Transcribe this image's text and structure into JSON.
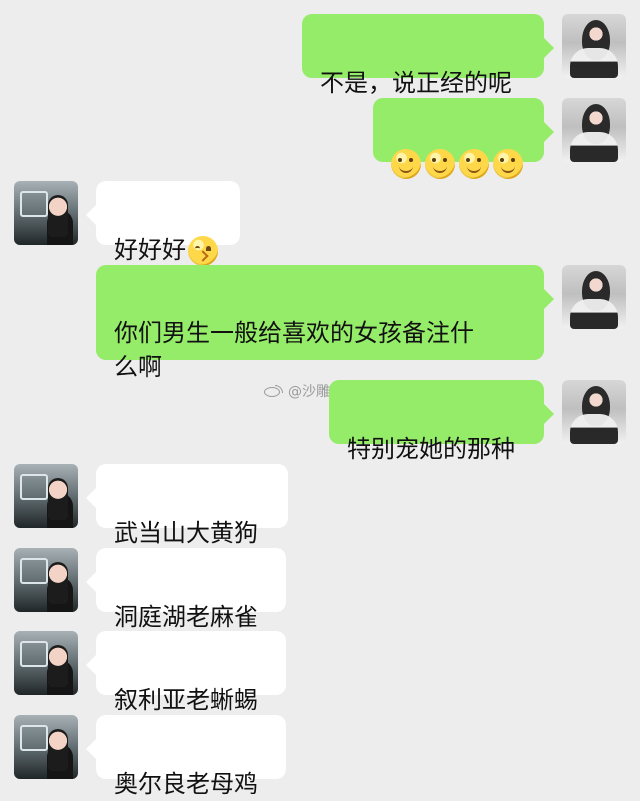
{
  "watermark": {
    "text": "@沙雕组织",
    "icon": "weibo-icon"
  },
  "messages": [
    {
      "side": "right",
      "text": "不是，说正经的呢",
      "avatar_icon": "female-avatar-icon"
    },
    {
      "side": "right",
      "emoji_count": 4,
      "emoji_icon": "smiling-face-icon",
      "avatar_icon": "female-avatar-icon"
    },
    {
      "side": "left",
      "text": "好好好",
      "emoji_icon": "kissing-face-icon",
      "avatar_icon": "male-avatar-icon"
    },
    {
      "side": "right",
      "text": "你们男生一般给喜欢的女孩备注什\n么啊",
      "avatar_icon": "female-avatar-icon"
    },
    {
      "side": "right",
      "text": "特别宠她的那种",
      "avatar_icon": "female-avatar-icon"
    },
    {
      "side": "left",
      "text": "武当山大黄狗",
      "avatar_icon": "male-avatar-icon"
    },
    {
      "side": "left",
      "text": "洞庭湖老麻雀",
      "avatar_icon": "male-avatar-icon"
    },
    {
      "side": "left",
      "text": "叙利亚老蜥蜴",
      "avatar_icon": "male-avatar-icon"
    },
    {
      "side": "left",
      "text": "奥尔良老母鸡",
      "avatar_icon": "male-avatar-icon"
    }
  ],
  "colors": {
    "background": "#ededed",
    "outgoing_bubble": "#95ec69",
    "incoming_bubble": "#ffffff",
    "text": "#111111",
    "watermark": "#8c8c8c"
  }
}
